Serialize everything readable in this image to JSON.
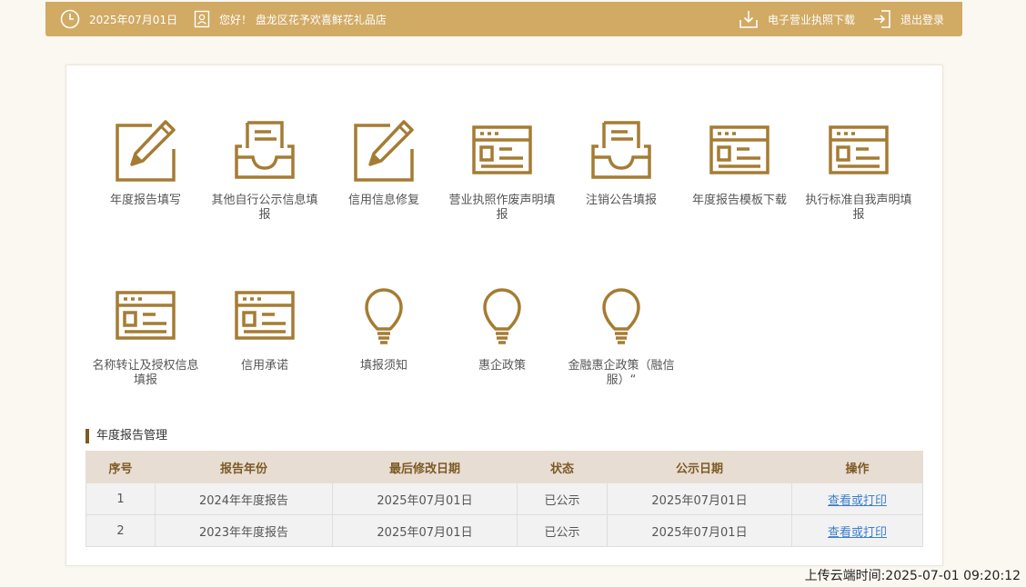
{
  "header": {
    "date": "2025年07月01日",
    "greeting": "您好！ 盘龙区花予欢喜鲜花礼品店",
    "download_license": "电子营业执照下载",
    "logout": "退出登录"
  },
  "tiles": [
    {
      "label": "年度报告填写",
      "icon": "edit-icon"
    },
    {
      "label": "其他自行公示信息填报",
      "icon": "inbox-icon"
    },
    {
      "label": "信用信息修复",
      "icon": "edit-icon"
    },
    {
      "label": "营业执照作废声明填报",
      "icon": "form-icon"
    },
    {
      "label": "注销公告填报",
      "icon": "inbox-icon"
    },
    {
      "label": "年度报告模板下载",
      "icon": "form-icon"
    },
    {
      "label": "执行标准自我声明填报",
      "icon": "form-icon"
    },
    {
      "label": "名称转让及授权信息填报",
      "icon": "form-icon"
    },
    {
      "label": "信用承诺",
      "icon": "form-icon"
    },
    {
      "label": "填报须知",
      "icon": "bulb-icon"
    },
    {
      "label": "惠企政策",
      "icon": "bulb-icon"
    },
    {
      "label": "金融惠企政策（融信服）“",
      "icon": "bulb-icon"
    }
  ],
  "annual_reports": {
    "title": "年度报告管理",
    "columns": [
      "序号",
      "报告年份",
      "最后修改日期",
      "状态",
      "公示日期",
      "操作"
    ],
    "rows": [
      {
        "no": "1",
        "year": "2024年年度报告",
        "modified": "2025年07月01日",
        "status": "已公示",
        "published": "2025年07月01日",
        "action": "查看或打印"
      },
      {
        "no": "2",
        "year": "2023年年度报告",
        "modified": "2025年07月01日",
        "status": "已公示",
        "published": "2025年07月01日",
        "action": "查看或打印"
      }
    ]
  },
  "upload_time": "上传云端时间:2025-07-01 09:20:12",
  "colors": {
    "accent": "#d1aa64",
    "icon": "#a57c34",
    "header_text": "#7d5a24",
    "link": "#3d7fcc"
  }
}
